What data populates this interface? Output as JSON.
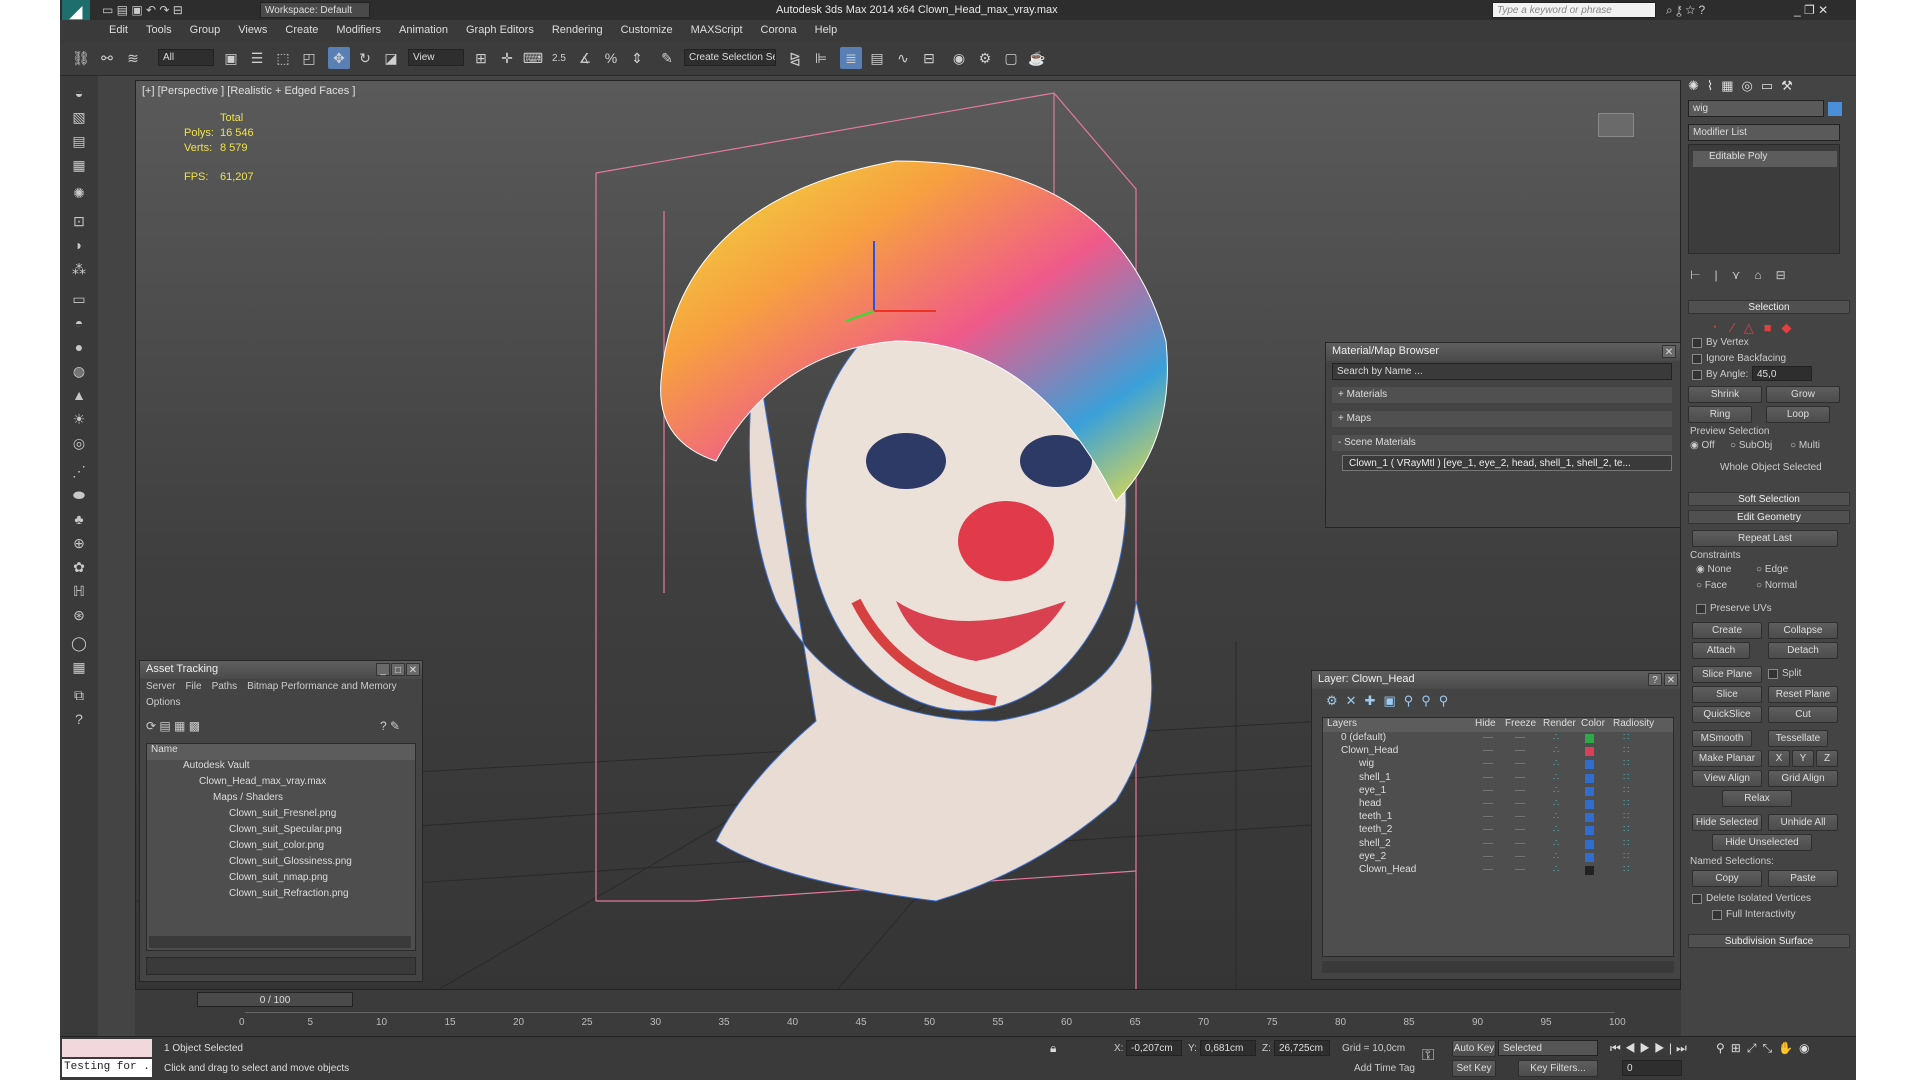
{
  "title_bar": {
    "workspace": "Workspace: Default",
    "title": "Autodesk 3ds Max  2014 x64     Clown_Head_max_vray.max",
    "search_placeholder": "Type a keyword or phrase"
  },
  "menu": [
    "Edit",
    "Tools",
    "Group",
    "Views",
    "Create",
    "Modifiers",
    "Animation",
    "Graph Editors",
    "Rendering",
    "Customize",
    "MAXScript",
    "Corona",
    "Help"
  ],
  "toolbar": {
    "filter": "All",
    "ref_coord": "View",
    "snap_value": "2.5",
    "selection_set": "Create Selection Se"
  },
  "viewport": {
    "label": "[+] [Perspective ] [Realistic + Edged Faces ]",
    "stats_header": "Total",
    "polys_label": "Polys:",
    "polys": "16 546",
    "verts_label": "Verts:",
    "verts": "8 579",
    "fps_label": "FPS:",
    "fps": "61,207"
  },
  "asset_tracking": {
    "title": "Asset Tracking",
    "menu": [
      "Server",
      "File",
      "Paths",
      "Bitmap Performance and Memory"
    ],
    "options": "Options",
    "col_name": "Name",
    "items": [
      "Autodesk Vault",
      "Clown_Head_max_vray.max",
      "Maps / Shaders",
      "Clown_suit_Fresnel.png",
      "Clown_suit_Specular.png",
      "Clown_suit_color.png",
      "Clown_suit_Glossiness.png",
      "Clown_suit_nmap.png",
      "Clown_suit_Refraction.png"
    ]
  },
  "material_browser": {
    "title": "Material/Map Browser",
    "search": "Search by Name ...",
    "materials": "+ Materials",
    "maps": "+ Maps",
    "scene_materials": "- Scene Materials",
    "entry": "Clown_1  ( VRayMtl ) [eye_1, eye_2, head, shell_1, shell_2, te..."
  },
  "layer_panel": {
    "title": "Layer: Clown_Head",
    "columns": [
      "Layers",
      "Hide",
      "Freeze",
      "Render",
      "Color",
      "Radiosity"
    ],
    "layers": [
      {
        "name": "0 (default)",
        "color": "#2fa84a"
      },
      {
        "name": "Clown_Head",
        "color": "#d9405c"
      },
      {
        "name": "wig",
        "color": "#2f6ed0"
      },
      {
        "name": "shell_1",
        "color": "#2f6ed0"
      },
      {
        "name": "eye_1",
        "color": "#2f6ed0"
      },
      {
        "name": "head",
        "color": "#2f6ed0"
      },
      {
        "name": "teeth_1",
        "color": "#2f6ed0"
      },
      {
        "name": "teeth_2",
        "color": "#2f6ed0"
      },
      {
        "name": "shell_2",
        "color": "#2f6ed0"
      },
      {
        "name": "eye_2",
        "color": "#2f6ed0"
      },
      {
        "name": "Clown_Head",
        "color": "#222222"
      }
    ]
  },
  "command_panel": {
    "object_name": "wig",
    "modifier_list": "Modifier List",
    "stack_item": "Editable Poly",
    "selection": "Selection",
    "by_vertex": "By Vertex",
    "ignore_backfacing": "Ignore Backfacing",
    "by_angle": "By Angle:",
    "angle": "45,0",
    "shrink": "Shrink",
    "grow": "Grow",
    "ring": "Ring",
    "loop": "Loop",
    "preview_selection": "Preview Selection",
    "off": "Off",
    "subobj": "SubObj",
    "multi": "Multi",
    "whole_selected": "Whole Object Selected",
    "soft_selection": "Soft Selection",
    "edit_geometry": "Edit Geometry",
    "repeat_last": "Repeat Last",
    "constraints": "Constraints",
    "none": "None",
    "edge": "Edge",
    "face": "Face",
    "normal": "Normal",
    "preserve_uvs": "Preserve UVs",
    "create": "Create",
    "collapse": "Collapse",
    "attach": "Attach",
    "detach": "Detach",
    "slice_plane": "Slice Plane",
    "split": "Split",
    "slice": "Slice",
    "reset_plane": "Reset Plane",
    "quickslice": "QuickSlice",
    "cut": "Cut",
    "msmooth": "MSmooth",
    "tessellate": "Tessellate",
    "make_planar": "Make Planar",
    "x": "X",
    "y": "Y",
    "z": "Z",
    "view_align": "View Align",
    "grid_align": "Grid Align",
    "relax": "Relax",
    "hide_selected": "Hide Selected",
    "unhide_all": "Unhide All",
    "hide_unselected": "Hide Unselected",
    "named_selections": "Named Selections:",
    "copy": "Copy",
    "paste": "Paste",
    "delete_isolated": "Delete Isolated Vertices",
    "full_interactivity": "Full Interactivity",
    "subdivision_surface": "Subdivision Surface"
  },
  "timeline": {
    "frame": "0 / 100",
    "ticks": [
      "0",
      "5",
      "10",
      "15",
      "20",
      "25",
      "30",
      "35",
      "40",
      "45",
      "50",
      "55",
      "60",
      "65",
      "70",
      "75",
      "80",
      "85",
      "90",
      "95",
      "100"
    ]
  },
  "status": {
    "maxscript": "Testing for .",
    "selected": "1 Object Selected",
    "prompt": "Click and drag to select and move objects",
    "x_label": "X:",
    "x": "-0,207cm",
    "y_label": "Y:",
    "y": "0,681cm",
    "z_label": "Z:",
    "z": "26,725cm",
    "grid": "Grid = 10,0cm",
    "add_time_tag": "Add Time Tag",
    "auto_key": "Auto Key",
    "selected_mode": "Selected",
    "set_key": "Set Key",
    "key_filters": "Key Filters...",
    "frame_field": "0"
  }
}
